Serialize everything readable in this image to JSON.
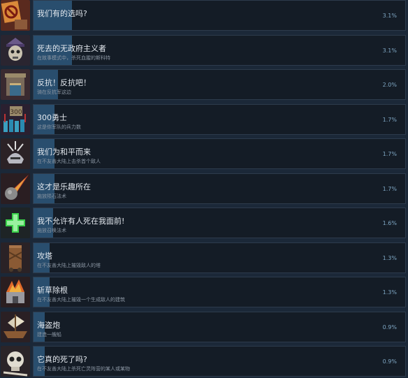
{
  "achievements": [
    {
      "title": "我们有的选吗?",
      "description": "",
      "percent_label": "3.1%",
      "percent": 3.1,
      "icon": "no-fire-sign-icon"
    },
    {
      "title": "死去的无政府主义者",
      "description": "在故事模式中，杀死血腥的斯科特",
      "percent_label": "3.1%",
      "percent": 3.1,
      "icon": "skull-hat-icon"
    },
    {
      "title": "反抗！反抗吧！",
      "description": "骑在反抗军这边",
      "percent_label": "2.0%",
      "percent": 2.0,
      "icon": "tower-gate-icon"
    },
    {
      "title": "300勇士",
      "description": "这是你军队的兵力数",
      "percent_label": "1.7%",
      "percent": 1.7,
      "icon": "army-300-icon"
    },
    {
      "title": "我们为和平而来",
      "description": "在不友善大陆上击杀首个敌人",
      "percent_label": "1.7%",
      "percent": 1.7,
      "icon": "spiked-helmet-icon"
    },
    {
      "title": "这才是乐趣所在",
      "description": "施放陨石法术",
      "percent_label": "1.7%",
      "percent": 1.7,
      "icon": "meteor-icon"
    },
    {
      "title": "我不允许有人死在我面前!",
      "description": "施放召唤法术",
      "percent_label": "1.6%",
      "percent": 1.6,
      "icon": "green-cross-icon"
    },
    {
      "title": "攻塔",
      "description": "在不友善大陆上摧毁敌人的塔",
      "percent_label": "1.3%",
      "percent": 1.3,
      "icon": "siege-tower-icon"
    },
    {
      "title": "斩草除根",
      "description": "在不友善大陆上摧毁一个生成敌人的建筑",
      "percent_label": "1.3%",
      "percent": 1.3,
      "icon": "burning-building-icon"
    },
    {
      "title": "海盗炮",
      "description": "建造一艘船",
      "percent_label": "0.9%",
      "percent": 0.9,
      "icon": "pirate-ship-icon"
    },
    {
      "title": "它真的死了吗?",
      "description": "在不友善大陆上杀死亡灵阵营的某人或某物",
      "percent_label": "0.9%",
      "percent": 0.9,
      "icon": "bone-skull-icon"
    }
  ],
  "colors": {
    "background": "#1b2838",
    "card": "#141c26",
    "card_border": "#2d3b4c",
    "progress_fill": "#294e6e",
    "title": "#e3e8ee",
    "description": "#8b96a3",
    "percent": "#7fa7c4"
  }
}
